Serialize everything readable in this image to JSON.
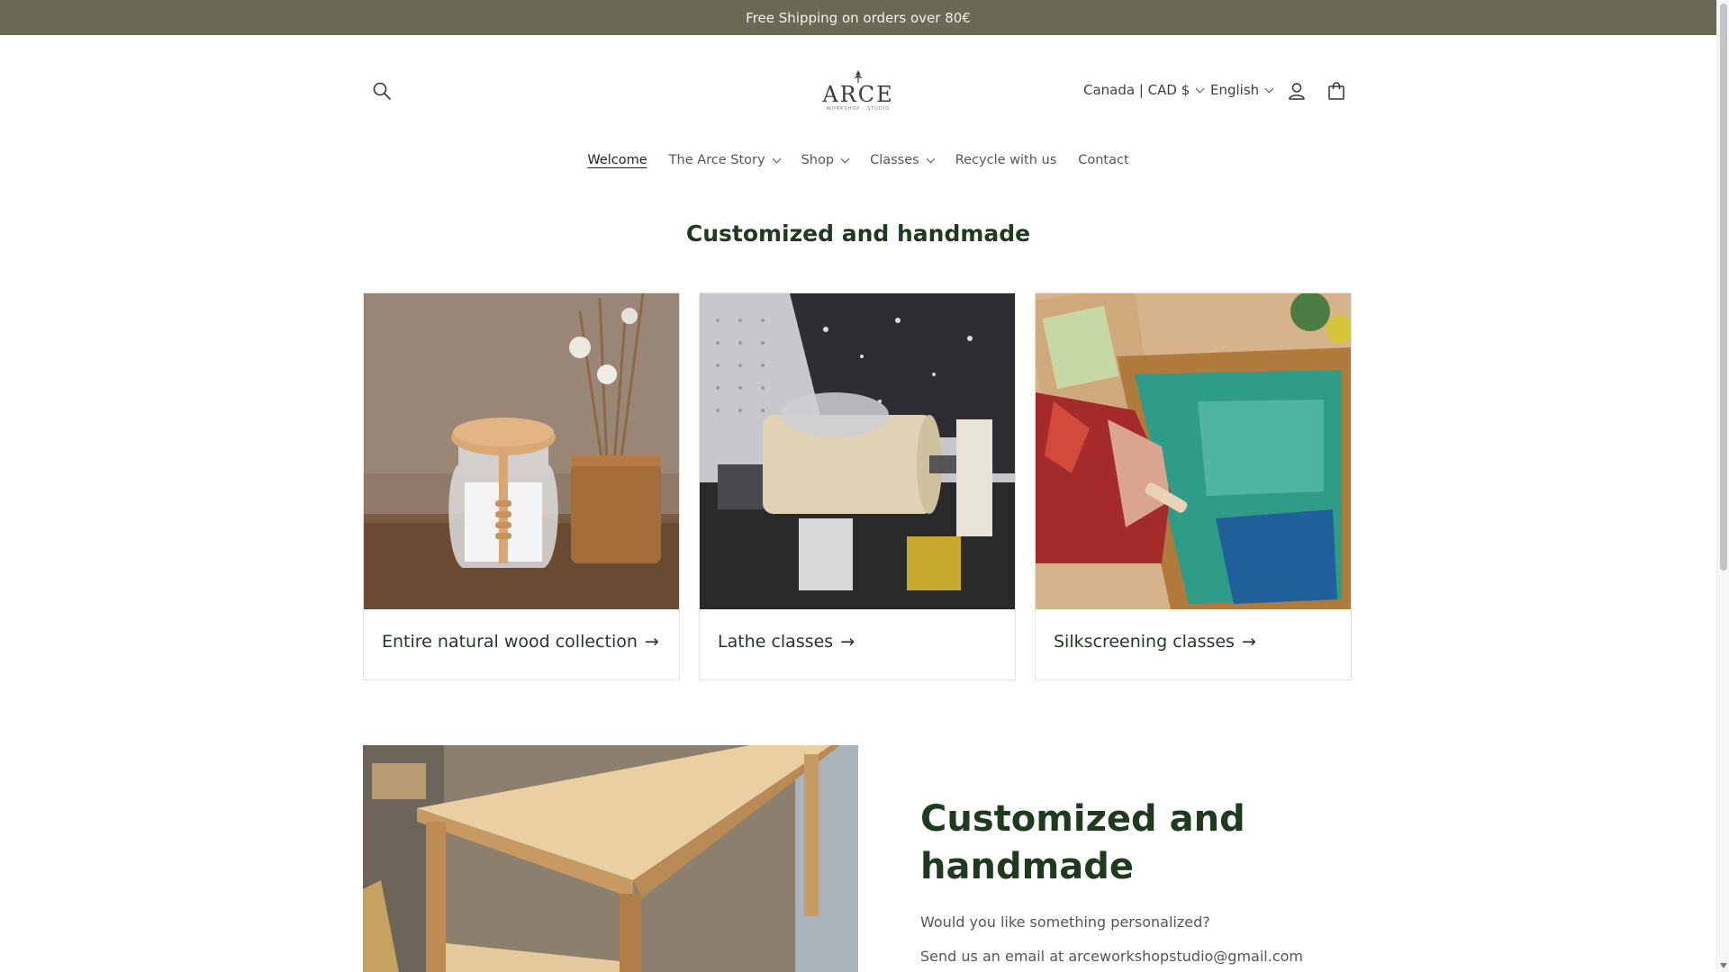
{
  "announcement": "Free Shipping on orders over 80€",
  "header": {
    "logo_text": "ARCE",
    "logo_tagline": "WORKSHOP · STUDIO",
    "country_selector": "Canada | CAD $",
    "language_selector": "English"
  },
  "nav": {
    "items": [
      {
        "label": "Welcome",
        "dropdown": false,
        "active": true
      },
      {
        "label": "The Arce Story",
        "dropdown": true
      },
      {
        "label": "Shop",
        "dropdown": true
      },
      {
        "label": "Classes",
        "dropdown": true
      },
      {
        "label": "Recycle with us",
        "dropdown": false
      },
      {
        "label": "Contact",
        "dropdown": false
      }
    ]
  },
  "collections": {
    "title": "Customized and handmade",
    "cards": [
      {
        "label": "Entire natural wood collection",
        "arrow": "→"
      },
      {
        "label": "Lathe classes",
        "arrow": "→"
      },
      {
        "label": "Silkscreening classes",
        "arrow": "→"
      }
    ]
  },
  "feature": {
    "title": "Customized and handmade",
    "line1": "Would you like something personalized?",
    "line2": "Send us an email at arceworkshopstudio@gmail.com"
  },
  "colors": {
    "announcement_bg": "#6b6955",
    "heading_green": "#1f3a1f"
  }
}
